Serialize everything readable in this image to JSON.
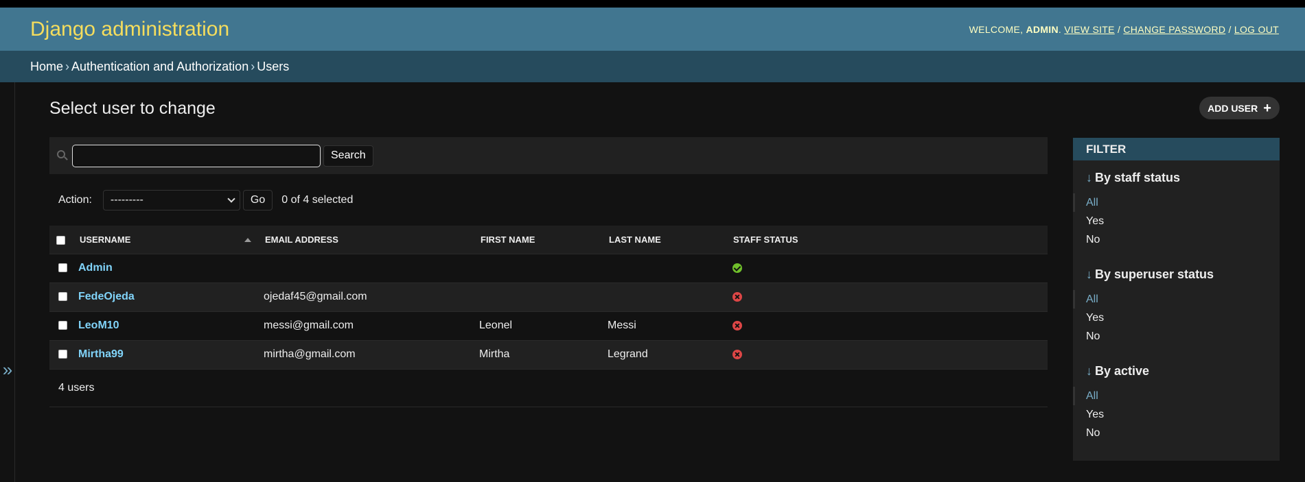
{
  "header": {
    "branding": "Django administration",
    "welcome": "Welcome,",
    "username": "admin",
    "view_site": "View site",
    "change_password": "Change password",
    "log_out": "Log out"
  },
  "breadcrumbs": {
    "home": "Home",
    "app": "Authentication and Authorization",
    "current": "Users"
  },
  "nav_toggle": "»",
  "page": {
    "title": "Select user to change",
    "add_button": "Add user"
  },
  "search": {
    "value": "",
    "button": "Search"
  },
  "actions": {
    "label": "Action:",
    "selected_option": "---------",
    "go": "Go",
    "selected_count": "0 of 4 selected"
  },
  "table": {
    "columns": [
      "Username",
      "Email address",
      "First name",
      "Last name",
      "Staff status"
    ],
    "rows": [
      {
        "username": "Admin",
        "email": "",
        "first_name": "",
        "last_name": "",
        "staff_status": true
      },
      {
        "username": "FedeOjeda",
        "email": "ojedaf45@gmail.com",
        "first_name": "",
        "last_name": "",
        "staff_status": false
      },
      {
        "username": "LeoM10",
        "email": "messi@gmail.com",
        "first_name": "Leonel",
        "last_name": "Messi",
        "staff_status": false
      },
      {
        "username": "Mirtha99",
        "email": "mirtha@gmail.com",
        "first_name": "Mirtha",
        "last_name": "Legrand",
        "staff_status": false
      }
    ]
  },
  "paginator": "4 users",
  "filter": {
    "title": "Filter",
    "groups": [
      {
        "title": "By staff status",
        "options": [
          "All",
          "Yes",
          "No"
        ]
      },
      {
        "title": "By superuser status",
        "options": [
          "All",
          "Yes",
          "No"
        ]
      },
      {
        "title": "By active",
        "options": [
          "All",
          "Yes",
          "No"
        ]
      }
    ]
  },
  "colors": {
    "header_bg": "#417690",
    "branding": "#f5dd5d",
    "breadcrumbs_bg": "#264b5d",
    "link": "#81d4fa",
    "yes": "#70bf2b",
    "no": "#dd4646"
  },
  "icons": {
    "search": "search-icon",
    "add": "plus-icon",
    "yes": "check-circle-icon",
    "no": "x-circle-icon",
    "sort": "sort-ascending-icon",
    "filter_arrow": "arrow-down-icon"
  }
}
